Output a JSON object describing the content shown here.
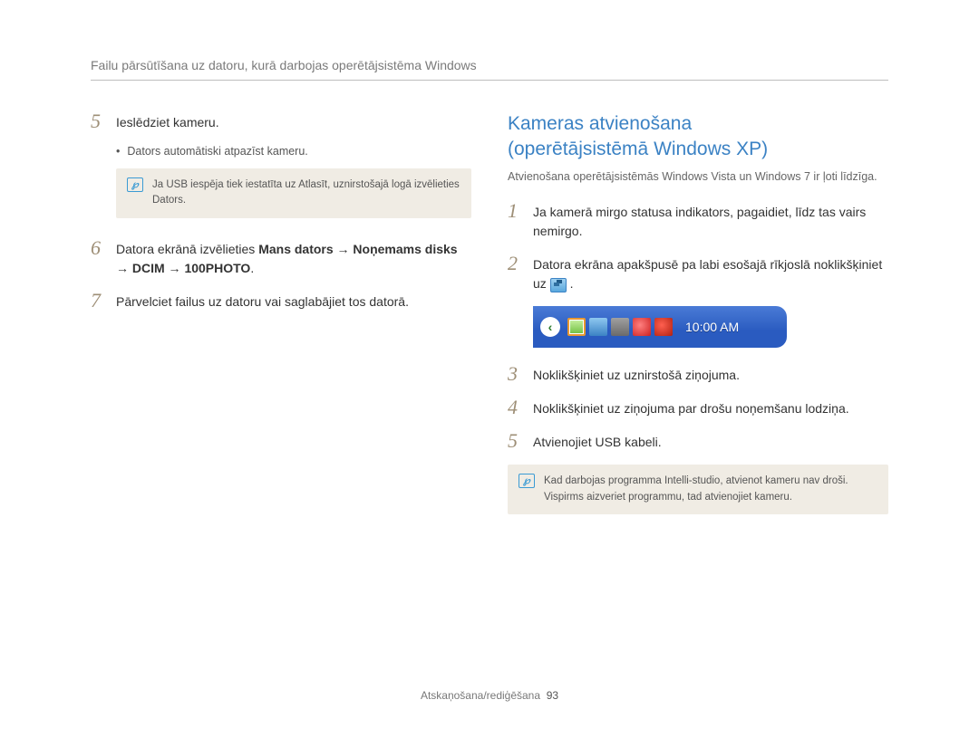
{
  "header": {
    "title": "Failu pārsūtīšana uz datoru, kurā darbojas operētājsistēma Windows"
  },
  "left": {
    "step5": {
      "num": "5",
      "text": "Ieslēdziet kameru."
    },
    "bullet5": "Dators automātiski atpazīst kameru.",
    "note1": {
      "pre": "Ja USB iespēja tiek iestatīta uz ",
      "b1": "Atlasīt",
      "mid": ", uznirstošajā logā izvēlieties ",
      "b2": "Dators",
      "post": "."
    },
    "step6": {
      "num": "6",
      "pre": "Datora ekrānā izvēlieties ",
      "bold": "Mans dators → Noņemams disks → DCIM → 100PHOTO",
      "post": "."
    },
    "step7": {
      "num": "7",
      "text": "Pārvelciet failus uz datoru vai saglabājiet tos datorā."
    }
  },
  "right": {
    "title_line1": "Kameras atvienošana",
    "title_line2": "(operētājsistēmā Windows XP)",
    "intro": "Atvienošana operētājsistēmās Windows Vista un Windows 7 ir ļoti līdzīga.",
    "step1": {
      "num": "1",
      "text": "Ja kamerā mirgo statusa indikators, pagaidiet, līdz tas vairs nemirgo."
    },
    "step2": {
      "num": "2",
      "pre": "Datora ekrāna apakšpusē pa labi esošajā rīkjoslā noklikšķiniet uz ",
      "post": "."
    },
    "clock": "10:00 AM",
    "step3": {
      "num": "3",
      "text": "Noklikšķiniet uz uznirstošā ziņojuma."
    },
    "step4": {
      "num": "4",
      "text": "Noklikšķiniet uz ziņojuma par drošu noņemšanu lodziņa."
    },
    "step5": {
      "num": "5",
      "text": "Atvienojiet USB kabeli."
    },
    "note2": "Kad darbojas programma Intelli-studio, atvienot kameru nav droši. Vispirms aizveriet programmu, tad atvienojiet kameru."
  },
  "footer": {
    "section": "Atskaņošana/rediģēšana",
    "page": "93"
  }
}
